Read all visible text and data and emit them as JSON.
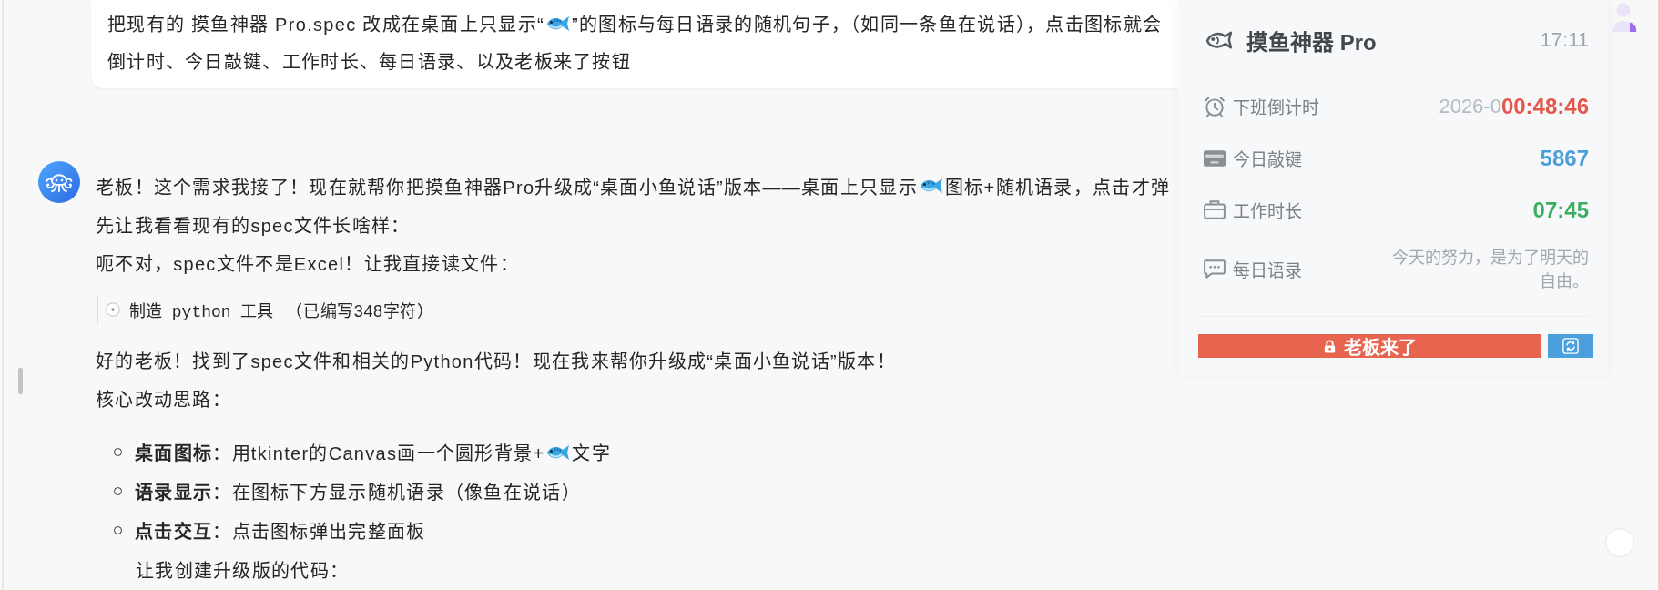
{
  "user_message": {
    "lines": [
      {
        "segments": [
          {
            "kind": "text",
            "text": "把现有的 摸鱼神器 Pro.spec 改成在桌面上只显示“"
          },
          {
            "kind": "icon"
          },
          {
            "kind": "text",
            "text": "”的图标与每日语录的随机句子，（如同一条鱼在说话），点击图标就会"
          }
        ]
      },
      {
        "segments": [
          {
            "kind": "text",
            "text": "倒计时、今日敲键、工作时长、每日语录、以及老板来了按钮"
          }
        ]
      }
    ]
  },
  "assistant_message": {
    "blocks": [
      {
        "kind": "paragraph",
        "segments": [
          {
            "kind": "text",
            "text": "老板！这个需求我接了！现在就帮你把摸鱼神器Pro升级成“桌面小鱼说话”版本——桌面上只显示"
          },
          {
            "kind": "icon"
          },
          {
            "kind": "text",
            "text": "图标+随机语录，点击才弹"
          }
        ]
      },
      {
        "kind": "paragraph",
        "segments": [
          {
            "kind": "text",
            "text": "先让我看看现有的spec文件长啥样："
          }
        ]
      },
      {
        "kind": "paragraph",
        "segments": [
          {
            "kind": "text",
            "text": "呃不对，spec文件不是Excel！让我直接读文件："
          }
        ]
      },
      {
        "kind": "tool",
        "name": "制造 python 工具",
        "detail": "（已编写348字符）"
      },
      {
        "kind": "paragraph",
        "segments": [
          {
            "kind": "text",
            "text": "好的老板！找到了spec文件和相关的Python代码！现在我来帮你升级成“桌面小鱼说话”版本！"
          }
        ]
      },
      {
        "kind": "paragraph",
        "segments": [
          {
            "kind": "text",
            "text": "核心改动思路："
          }
        ]
      },
      {
        "kind": "list",
        "items": [
          {
            "segments": [
              {
                "kind": "text",
                "text": "**桌面图标**：用tkinter的Canvas画一个圆形背景+"
              },
              {
                "kind": "icon"
              },
              {
                "kind": "text",
                "text": "文字"
              }
            ]
          },
          {
            "segments": [
              {
                "kind": "text",
                "text": "**语录显示**：在图标下方显示随机语录（像鱼在说话）"
              }
            ]
          },
          {
            "segments": [
              {
                "kind": "text",
                "text": "**点击交互**：点击图标弹出完整面板"
              }
            ]
          }
        ]
      },
      {
        "kind": "indented",
        "segments": [
          {
            "kind": "text",
            "text": "让我创建升级版的代码："
          }
        ]
      }
    ]
  },
  "overlay_panel": {
    "title": "摸鱼神器 Pro",
    "time": "17:11",
    "rows": [
      {
        "kind": "countdown",
        "label": "下班倒计时",
        "date": "2026-0",
        "value": "00:48:46",
        "color": "#e5574b"
      },
      {
        "kind": "keystrokes",
        "label": "今日敲键",
        "value": "5867",
        "color": "#4a9fd8"
      },
      {
        "kind": "duration",
        "label": "工作时长",
        "value": "07:45",
        "color": "#3aae5f"
      },
      {
        "kind": "quote",
        "label": "每日语录",
        "value": "今天的努力，是为了明天的自由。"
      }
    ],
    "buttons": [
      {
        "kind": "alert",
        "label": "老板来了"
      },
      {
        "kind": "refresh"
      }
    ]
  }
}
